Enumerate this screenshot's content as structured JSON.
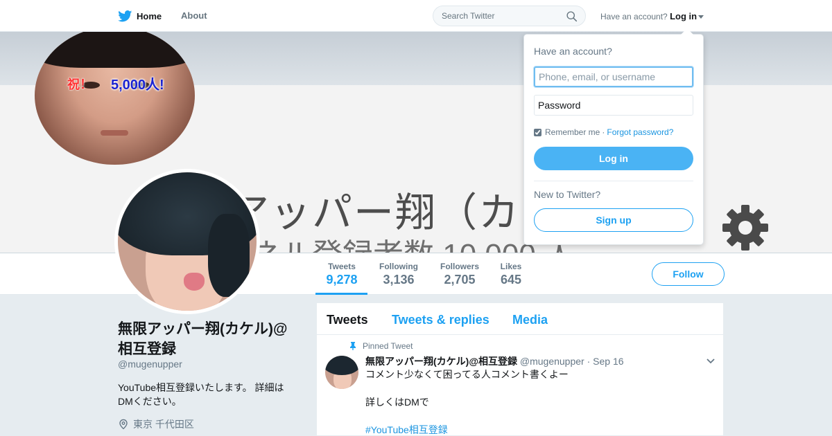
{
  "topbar": {
    "home_label": "Home",
    "about_label": "About",
    "search_placeholder": "Search Twitter",
    "account_prompt": "Have an account?",
    "login_label": "Log in"
  },
  "banner": {
    "badge_iwai": "祝！",
    "badge_count": "5,000人!",
    "title_text": "アッパー翔（カ",
    "subtitle_text": "ネル登録者数 10,000 人"
  },
  "stats": [
    {
      "label": "Tweets",
      "value": "9,278"
    },
    {
      "label": "Following",
      "value": "3,136"
    },
    {
      "label": "Followers",
      "value": "2,705"
    },
    {
      "label": "Likes",
      "value": "645"
    }
  ],
  "follow_label": "Follow",
  "profile": {
    "name": "無限アッパー翔(カケル)@相互登録",
    "handle": "@mugenupper",
    "bio": "YouTube相互登録いたします。 詳細はDMください。",
    "location": "東京 千代田区"
  },
  "timeline": {
    "tabs": [
      "Tweets",
      "Tweets & replies",
      "Media"
    ],
    "pinned_label": "Pinned Tweet",
    "tweet": {
      "author": "無限アッパー翔(カケル)@相互登録",
      "handle": "@mugenupper",
      "separator": "·",
      "date": "Sep 16",
      "line1": "コメント少なくて困ってる人コメント書くよー",
      "line2": "詳しくはDMで",
      "hashtag": "#YouTube相互登録"
    }
  },
  "login_dropdown": {
    "heading": "Have an account?",
    "username_placeholder": "Phone, email, or username",
    "password_placeholder": "Password",
    "remember_label": "Remember me",
    "separator": "·",
    "forgot_label": "Forgot password?",
    "login_button": "Log in",
    "new_prompt": "New to Twitter?",
    "signup_button": "Sign up"
  },
  "colors": {
    "accent": "#1da1f2",
    "login_button": "#4ab3f4",
    "link": "#1b95e0"
  }
}
